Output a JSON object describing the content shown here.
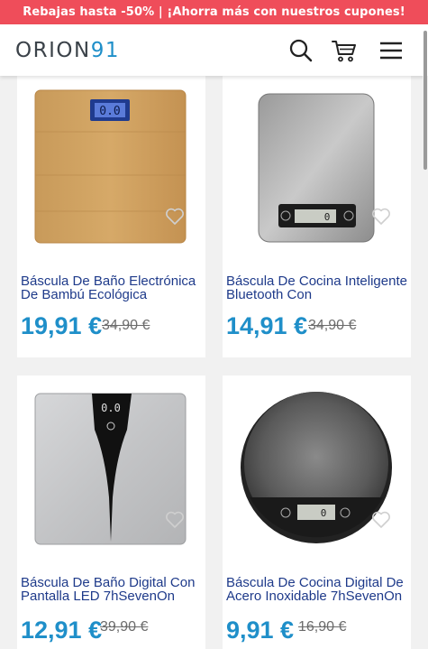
{
  "promo_bar": {
    "text": "Rebajas hasta -50% | ¡Ahorra más con nuestros cupones!",
    "color": "#ef4d5a"
  },
  "header": {
    "logo_part1": "ORION",
    "logo_part2": "91",
    "icons": [
      "search-icon",
      "cart-icon",
      "menu-icon"
    ]
  },
  "accent_color": "#1f8fc9",
  "products": [
    {
      "title": "Báscula De Baño Electrónica De Bambú Ecológica",
      "price": "19,91 €",
      "old_price": "34,90 €",
      "display": "0.0"
    },
    {
      "title": "Báscula De Cocina Inteligente Bluetooth Con",
      "price": "14,91 €",
      "old_price": "34,90 €",
      "display": "0"
    },
    {
      "title": "Báscula De Baño Digital Con Pantalla LED 7hSevenOn",
      "price": "12,91 €",
      "old_price": "39,90 €",
      "display": "0.0"
    },
    {
      "title": "Báscula De Cocina Digital De Acero Inoxidable 7hSevenOn",
      "price": "9,91 €",
      "old_price": "16,90 €",
      "display": "0"
    }
  ]
}
